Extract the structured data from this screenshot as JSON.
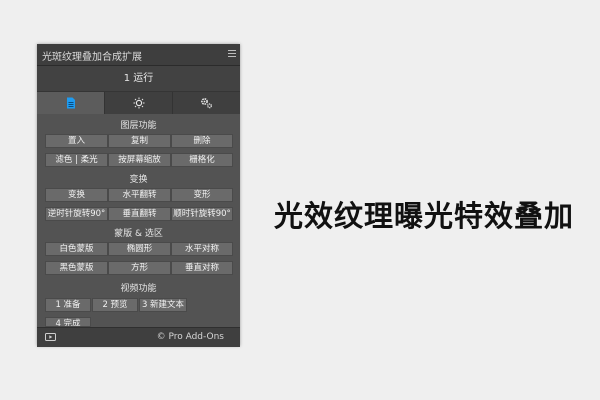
{
  "panel": {
    "title": "光斑纹理叠加合成扩展",
    "run_label": "1 运行",
    "tabs": [
      {
        "icon": "document-icon"
      },
      {
        "icon": "sun-icon"
      },
      {
        "icon": "gears-icon"
      }
    ],
    "sections": {
      "layer": "图层功能",
      "transform": "变换",
      "mask": "蒙版 & 选区",
      "video": "视频功能"
    },
    "buttons": {
      "place": "置入",
      "copy": "复制",
      "delete": "删除",
      "filter_soft": "滤色 | 柔光",
      "fit_screen": "按屏幕缩放",
      "rasterize": "栅格化",
      "transform": "变换",
      "flip_h": "水平翻转",
      "warp": "变形",
      "rotate_ccw": "逆时针旋转90°",
      "flip_v": "垂直翻转",
      "rotate_cw": "顺时针旋转90°",
      "white_mask": "白色蒙版",
      "ellipse": "椭圆形",
      "h_symmetric": "水平对称",
      "black_mask": "黑色蒙版",
      "square": "方形",
      "v_symmetric": "垂直对称",
      "prepare": "1 准备",
      "preview": "2 预览",
      "new_text": "3 新建文本",
      "complete": "4 完成"
    },
    "footer_credit": "© Pro Add-Ons"
  },
  "headline": "光效纹理曝光特效叠加"
}
